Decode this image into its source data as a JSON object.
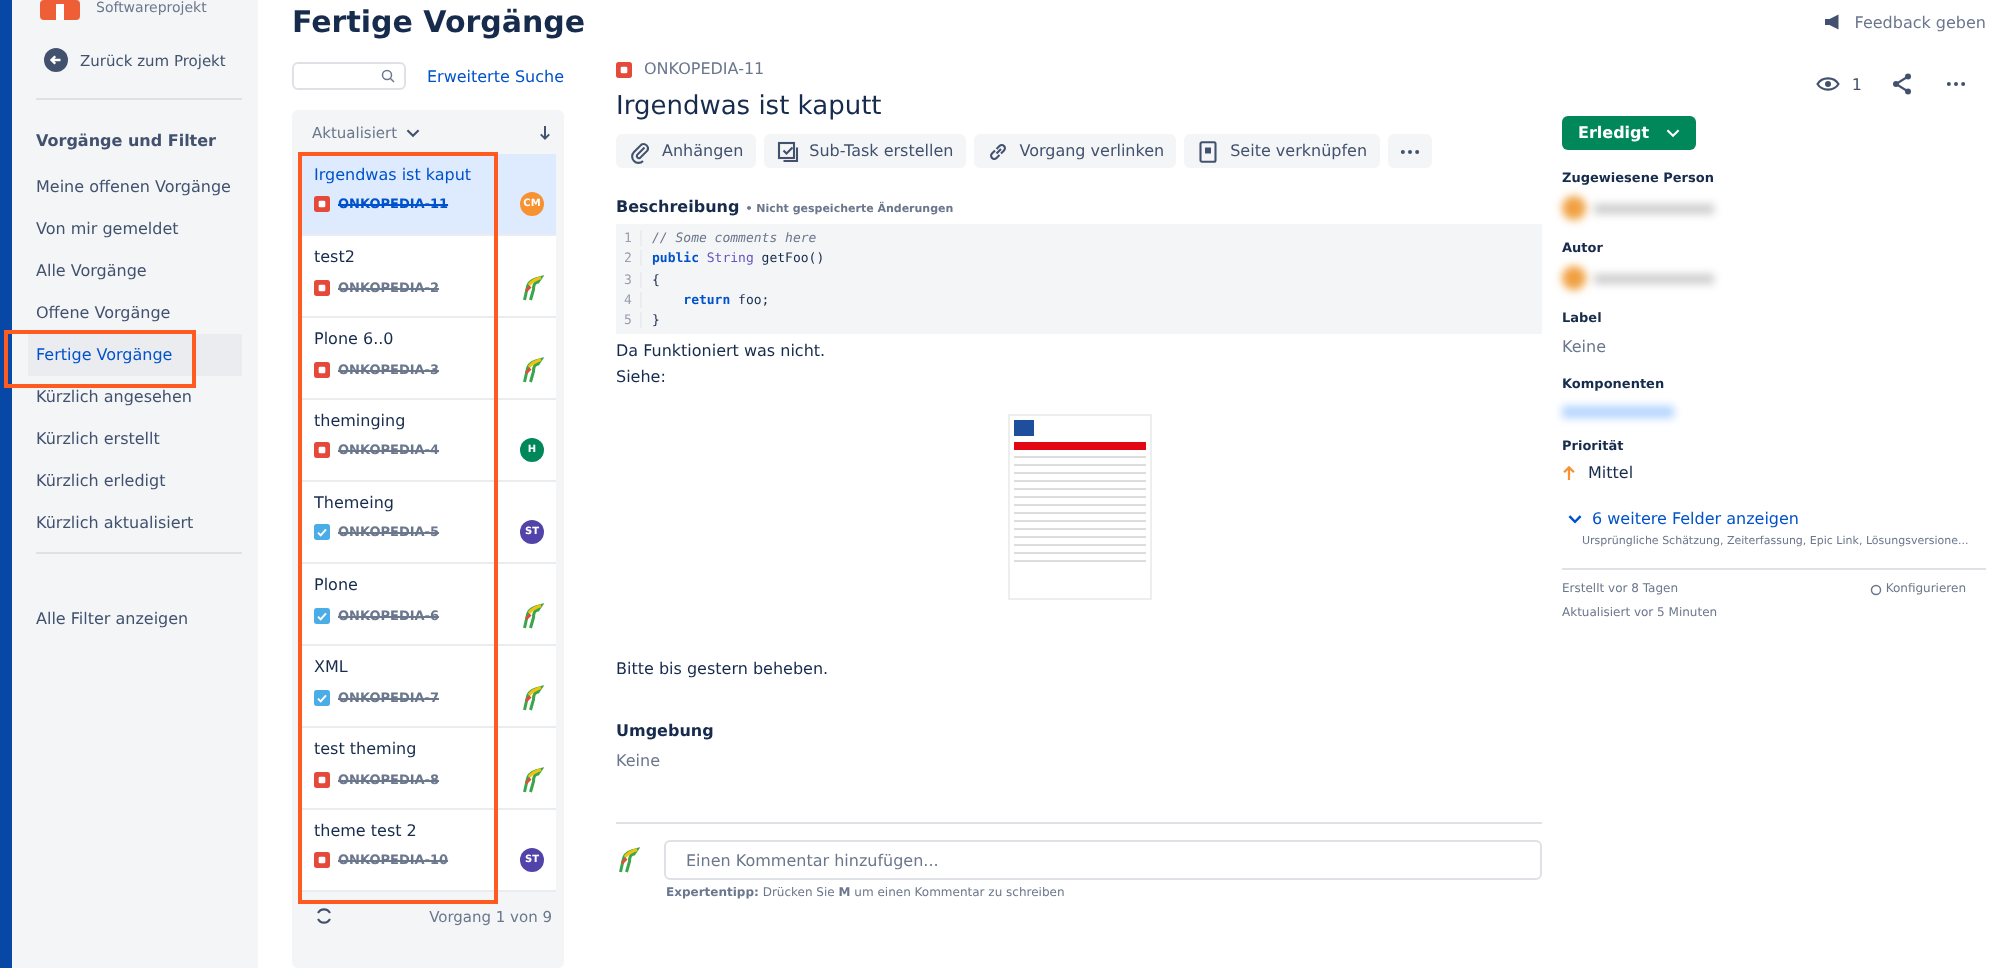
{
  "sidebar": {
    "project_subtitle": "Softwareprojekt",
    "back_link": "Zurück zum Projekt",
    "section_title": "Vorgänge und Filter",
    "items": [
      {
        "label": "Meine offenen Vorgänge",
        "selected": false
      },
      {
        "label": "Von mir gemeldet",
        "selected": false
      },
      {
        "label": "Alle Vorgänge",
        "selected": false
      },
      {
        "label": "Offene Vorgänge",
        "selected": false
      },
      {
        "label": "Fertige Vorgänge",
        "selected": true
      },
      {
        "label": "Kürzlich angesehen",
        "selected": false
      },
      {
        "label": "Kürzlich erstellt",
        "selected": false
      },
      {
        "label": "Kürzlich erledigt",
        "selected": false
      },
      {
        "label": "Kürzlich aktualisiert",
        "selected": false
      }
    ],
    "all_filters": "Alle Filter anzeigen"
  },
  "page_title": "Fertige Vorgänge",
  "feedback": "Feedback geben",
  "advanced_search": "Erweiterte Suche",
  "issue_list": {
    "sort": "Aktualisiert",
    "footer": "Vorgang 1 von 9",
    "issues": [
      {
        "title": "Irgendwas ist kaput",
        "key": "ONKOPEDIA-11",
        "kind": "bug",
        "done": true,
        "selected": true,
        "avatar": {
          "kind": "initials",
          "text": "CM",
          "color": "#f79232"
        }
      },
      {
        "title": "test2",
        "key": "ONKOPEDIA-2",
        "kind": "bug",
        "done": true,
        "selected": false,
        "avatar": {
          "kind": "logo"
        }
      },
      {
        "title": "Plone 6..0",
        "key": "ONKOPEDIA-3",
        "kind": "bug",
        "done": true,
        "selected": false,
        "avatar": {
          "kind": "logo"
        }
      },
      {
        "title": "theminging",
        "key": "ONKOPEDIA-4",
        "kind": "bug",
        "done": true,
        "selected": false,
        "avatar": {
          "kind": "initials",
          "text": "H",
          "color": "#00875a"
        }
      },
      {
        "title": "Themeing",
        "key": "ONKOPEDIA-5",
        "kind": "task",
        "done": true,
        "selected": false,
        "avatar": {
          "kind": "initials",
          "text": "ST",
          "color": "#5243aa"
        }
      },
      {
        "title": "Plone",
        "key": "ONKOPEDIA-6",
        "kind": "task",
        "done": true,
        "selected": false,
        "avatar": {
          "kind": "logo"
        }
      },
      {
        "title": "XML",
        "key": "ONKOPEDIA-7",
        "kind": "task",
        "done": true,
        "selected": false,
        "avatar": {
          "kind": "logo"
        }
      },
      {
        "title": "test theming",
        "key": "ONKOPEDIA-8",
        "kind": "bug",
        "done": true,
        "selected": false,
        "avatar": {
          "kind": "logo"
        }
      },
      {
        "title": "theme test 2",
        "key": "ONKOPEDIA-10",
        "kind": "bug",
        "done": true,
        "selected": false,
        "avatar": {
          "kind": "initials",
          "text": "ST",
          "color": "#5243aa"
        }
      }
    ]
  },
  "detail": {
    "key": "ONKOPEDIA-11",
    "title": "Irgendwas ist kaputt",
    "watchers": "1",
    "actions": [
      {
        "kind": "attach",
        "label": "Anhängen"
      },
      {
        "kind": "subtask",
        "label": "Sub-Task erstellen"
      },
      {
        "kind": "link",
        "label": "Vorgang verlinken"
      },
      {
        "kind": "page",
        "label": "Seite verknüpfen"
      }
    ],
    "description_label": "Beschreibung",
    "unsaved": "• Nicht gespeicherte Änderungen",
    "code": [
      {
        "num": "1",
        "tokens": [
          {
            "kind": "comment",
            "text": "// Some comments here"
          }
        ]
      },
      {
        "num": "2",
        "tokens": [
          {
            "kind": "keyword",
            "text": "public"
          },
          {
            "kind": "type",
            "text": " String"
          },
          {
            "kind": "plain",
            "text": " getFoo()"
          }
        ]
      },
      {
        "num": "3",
        "tokens": [
          {
            "kind": "plain",
            "text": "{"
          }
        ]
      },
      {
        "num": "4",
        "tokens": [
          {
            "kind": "keyword",
            "text": "    return"
          },
          {
            "kind": "plain",
            "text": " foo;"
          }
        ]
      },
      {
        "num": "5",
        "tokens": [
          {
            "kind": "plain",
            "text": "}"
          }
        ]
      }
    ],
    "text_lines": [
      "Da Funktioniert was nicht.",
      "Siehe:"
    ],
    "closing_line": "Bitte bis gestern beheben.",
    "environment_label": "Umgebung",
    "environment_value": "Keine",
    "comment_placeholder": "Einen Kommentar hinzufügen...",
    "tip": "**Expertentipp:** Drücken Sie **M** um einen Kommentar zu schreiben"
  },
  "side_panel": {
    "status": "Erledigt",
    "fields": [
      {
        "kind": "person",
        "label": "Zugewiesene Person"
      },
      {
        "kind": "person",
        "label": "Autor"
      },
      {
        "kind": "text",
        "label": "Label",
        "value": "Keine"
      },
      {
        "kind": "blurred",
        "label": "Komponenten"
      },
      {
        "kind": "priority",
        "label": "Priorität",
        "value": "Mittel"
      }
    ],
    "more_fields": "6 weitere Felder anzeigen",
    "more_fields_hint": "Ursprüngliche Schätzung, Zeiterfassung, Epic Link, Lösungsversione...",
    "created": "Erstellt vor 8 Tagen",
    "updated": "Aktualisiert vor 5 Minuten",
    "configure": "Konfigurieren"
  }
}
